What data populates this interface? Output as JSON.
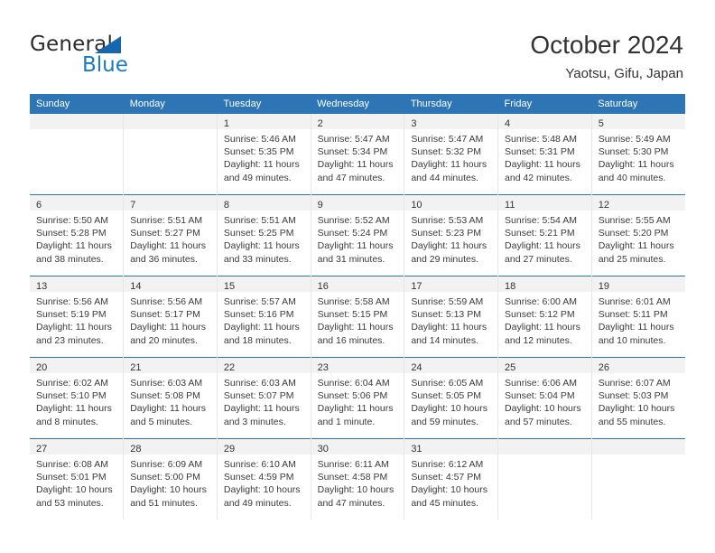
{
  "brand": {
    "name_part1": "General",
    "name_part2": "Blue",
    "triangle_icon": "triangle-icon",
    "accent_color": "#1667b2",
    "blue_text_color": "#1a7bc4"
  },
  "header": {
    "title": "October 2024",
    "subtitle": "Yaotsu, Gifu, Japan"
  },
  "theme": {
    "header_row_background": "#2e75b6",
    "daynum_band_background": "#f2f2f2",
    "week_separator_color": "#2e75b6",
    "text_color": "#3a3a3a"
  },
  "weekday_headers": [
    "Sunday",
    "Monday",
    "Tuesday",
    "Wednesday",
    "Thursday",
    "Friday",
    "Saturday"
  ],
  "labels": {
    "sunrise_prefix": "Sunrise:",
    "sunset_prefix": "Sunset:",
    "daylight_prefix": "Daylight:"
  },
  "weeks": [
    [
      {
        "day": "",
        "sunrise": "",
        "sunset": "",
        "daylight": "",
        "empty": true
      },
      {
        "day": "",
        "sunrise": "",
        "sunset": "",
        "daylight": "",
        "empty": true
      },
      {
        "day": "1",
        "sunrise": "Sunrise: 5:46 AM",
        "sunset": "Sunset: 5:35 PM",
        "daylight": "Daylight: 11 hours and 49 minutes.",
        "empty": false
      },
      {
        "day": "2",
        "sunrise": "Sunrise: 5:47 AM",
        "sunset": "Sunset: 5:34 PM",
        "daylight": "Daylight: 11 hours and 47 minutes.",
        "empty": false
      },
      {
        "day": "3",
        "sunrise": "Sunrise: 5:47 AM",
        "sunset": "Sunset: 5:32 PM",
        "daylight": "Daylight: 11 hours and 44 minutes.",
        "empty": false
      },
      {
        "day": "4",
        "sunrise": "Sunrise: 5:48 AM",
        "sunset": "Sunset: 5:31 PM",
        "daylight": "Daylight: 11 hours and 42 minutes.",
        "empty": false
      },
      {
        "day": "5",
        "sunrise": "Sunrise: 5:49 AM",
        "sunset": "Sunset: 5:30 PM",
        "daylight": "Daylight: 11 hours and 40 minutes.",
        "empty": false
      }
    ],
    [
      {
        "day": "6",
        "sunrise": "Sunrise: 5:50 AM",
        "sunset": "Sunset: 5:28 PM",
        "daylight": "Daylight: 11 hours and 38 minutes.",
        "empty": false
      },
      {
        "day": "7",
        "sunrise": "Sunrise: 5:51 AM",
        "sunset": "Sunset: 5:27 PM",
        "daylight": "Daylight: 11 hours and 36 minutes.",
        "empty": false
      },
      {
        "day": "8",
        "sunrise": "Sunrise: 5:51 AM",
        "sunset": "Sunset: 5:25 PM",
        "daylight": "Daylight: 11 hours and 33 minutes.",
        "empty": false
      },
      {
        "day": "9",
        "sunrise": "Sunrise: 5:52 AM",
        "sunset": "Sunset: 5:24 PM",
        "daylight": "Daylight: 11 hours and 31 minutes.",
        "empty": false
      },
      {
        "day": "10",
        "sunrise": "Sunrise: 5:53 AM",
        "sunset": "Sunset: 5:23 PM",
        "daylight": "Daylight: 11 hours and 29 minutes.",
        "empty": false
      },
      {
        "day": "11",
        "sunrise": "Sunrise: 5:54 AM",
        "sunset": "Sunset: 5:21 PM",
        "daylight": "Daylight: 11 hours and 27 minutes.",
        "empty": false
      },
      {
        "day": "12",
        "sunrise": "Sunrise: 5:55 AM",
        "sunset": "Sunset: 5:20 PM",
        "daylight": "Daylight: 11 hours and 25 minutes.",
        "empty": false
      }
    ],
    [
      {
        "day": "13",
        "sunrise": "Sunrise: 5:56 AM",
        "sunset": "Sunset: 5:19 PM",
        "daylight": "Daylight: 11 hours and 23 minutes.",
        "empty": false
      },
      {
        "day": "14",
        "sunrise": "Sunrise: 5:56 AM",
        "sunset": "Sunset: 5:17 PM",
        "daylight": "Daylight: 11 hours and 20 minutes.",
        "empty": false
      },
      {
        "day": "15",
        "sunrise": "Sunrise: 5:57 AM",
        "sunset": "Sunset: 5:16 PM",
        "daylight": "Daylight: 11 hours and 18 minutes.",
        "empty": false
      },
      {
        "day": "16",
        "sunrise": "Sunrise: 5:58 AM",
        "sunset": "Sunset: 5:15 PM",
        "daylight": "Daylight: 11 hours and 16 minutes.",
        "empty": false
      },
      {
        "day": "17",
        "sunrise": "Sunrise: 5:59 AM",
        "sunset": "Sunset: 5:13 PM",
        "daylight": "Daylight: 11 hours and 14 minutes.",
        "empty": false
      },
      {
        "day": "18",
        "sunrise": "Sunrise: 6:00 AM",
        "sunset": "Sunset: 5:12 PM",
        "daylight": "Daylight: 11 hours and 12 minutes.",
        "empty": false
      },
      {
        "day": "19",
        "sunrise": "Sunrise: 6:01 AM",
        "sunset": "Sunset: 5:11 PM",
        "daylight": "Daylight: 11 hours and 10 minutes.",
        "empty": false
      }
    ],
    [
      {
        "day": "20",
        "sunrise": "Sunrise: 6:02 AM",
        "sunset": "Sunset: 5:10 PM",
        "daylight": "Daylight: 11 hours and 8 minutes.",
        "empty": false
      },
      {
        "day": "21",
        "sunrise": "Sunrise: 6:03 AM",
        "sunset": "Sunset: 5:08 PM",
        "daylight": "Daylight: 11 hours and 5 minutes.",
        "empty": false
      },
      {
        "day": "22",
        "sunrise": "Sunrise: 6:03 AM",
        "sunset": "Sunset: 5:07 PM",
        "daylight": "Daylight: 11 hours and 3 minutes.",
        "empty": false
      },
      {
        "day": "23",
        "sunrise": "Sunrise: 6:04 AM",
        "sunset": "Sunset: 5:06 PM",
        "daylight": "Daylight: 11 hours and 1 minute.",
        "empty": false
      },
      {
        "day": "24",
        "sunrise": "Sunrise: 6:05 AM",
        "sunset": "Sunset: 5:05 PM",
        "daylight": "Daylight: 10 hours and 59 minutes.",
        "empty": false
      },
      {
        "day": "25",
        "sunrise": "Sunrise: 6:06 AM",
        "sunset": "Sunset: 5:04 PM",
        "daylight": "Daylight: 10 hours and 57 minutes.",
        "empty": false
      },
      {
        "day": "26",
        "sunrise": "Sunrise: 6:07 AM",
        "sunset": "Sunset: 5:03 PM",
        "daylight": "Daylight: 10 hours and 55 minutes.",
        "empty": false
      }
    ],
    [
      {
        "day": "27",
        "sunrise": "Sunrise: 6:08 AM",
        "sunset": "Sunset: 5:01 PM",
        "daylight": "Daylight: 10 hours and 53 minutes.",
        "empty": false
      },
      {
        "day": "28",
        "sunrise": "Sunrise: 6:09 AM",
        "sunset": "Sunset: 5:00 PM",
        "daylight": "Daylight: 10 hours and 51 minutes.",
        "empty": false
      },
      {
        "day": "29",
        "sunrise": "Sunrise: 6:10 AM",
        "sunset": "Sunset: 4:59 PM",
        "daylight": "Daylight: 10 hours and 49 minutes.",
        "empty": false
      },
      {
        "day": "30",
        "sunrise": "Sunrise: 6:11 AM",
        "sunset": "Sunset: 4:58 PM",
        "daylight": "Daylight: 10 hours and 47 minutes.",
        "empty": false
      },
      {
        "day": "31",
        "sunrise": "Sunrise: 6:12 AM",
        "sunset": "Sunset: 4:57 PM",
        "daylight": "Daylight: 10 hours and 45 minutes.",
        "empty": false
      },
      {
        "day": "",
        "sunrise": "",
        "sunset": "",
        "daylight": "",
        "empty": true
      },
      {
        "day": "",
        "sunrise": "",
        "sunset": "",
        "daylight": "",
        "empty": true
      }
    ]
  ]
}
